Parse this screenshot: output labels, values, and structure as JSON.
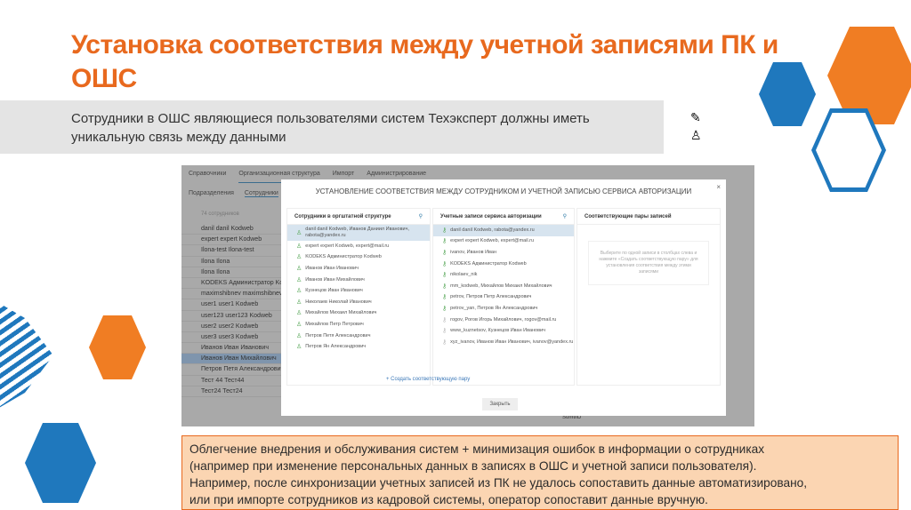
{
  "title": "Установка соответствия между учетной записями ПК и ОШС",
  "subtitle_lines": [
    "Сотрудники в ОШС являющиеся пользователями систем Техэксперт должны иметь",
    "уникальную связь между данными"
  ],
  "icons": [
    "pen-icon",
    "person-icon"
  ],
  "app": {
    "menu": [
      "Справочники",
      "Организационная структура",
      "Импорт",
      "Администрирование"
    ],
    "submenu": [
      "Подразделения",
      "Сотрудники",
      "До"
    ],
    "search_placeholder": "74 сотрудников",
    "employees": [
      "danil danil Kodweb",
      "expert expert Kodweb",
      "Ilona-test Ilona-test",
      "Ilona Ilona",
      "Ilona Ilona",
      "KODEKS Администратор Kodweb",
      "maximshibnev maximshibnev Ko...",
      "user1 user1 Kodweb",
      "user123 user123 Kodweb",
      "user2 user2 Kodweb",
      "user3 user3 Kodweb",
      "Иванов Иван Иванович",
      "Иванов Иван Михайлович",
      "Петров Петя Александрович",
      "Тест 44 Тест44",
      "Тест24 Тест24"
    ],
    "selected_employee": 12,
    "bottom_label": "SumtiID"
  },
  "dialog": {
    "title": "УСТАНОВЛЕНИЕ СООТВЕТСТВИЯ МЕЖДУ СОТРУДНИКОМ И УЧЕТНОЙ ЗАПИСЬЮ СЕРВИСА АВТОРИЗАЦИИ",
    "close": "×",
    "col1_header": "Сотрудники в оргштатной структуре",
    "col1": [
      "danil danil Kodweb, Иванов Даниил Иванович, rabota@yandex.ru",
      "expert expert Kodweb, expert@mail.ru",
      "KODEKS Администратор Kodweb",
      "Иванов Иван Иванович",
      "Иванов Иван Михайлович",
      "Кузнецов Иван Иванович",
      "Николаев Николай Иванович",
      "Михайлов Михаил Михайлович",
      "Михайлов Петр Петрович",
      "Петров Петя Александрович",
      "Петров Ян Александрович"
    ],
    "col2_header": "Учетные записи сервиса авторизации",
    "col2": [
      "danil danil Kodweb, rabota@yandex.ru",
      "expert expert Kodweb, expert@mail.ru",
      "ivanov, Иванов Иван",
      "KODEKS Администратор Kodweb",
      "nikolaev_nik",
      "mm_kodweb, Михайлов Михаил Михайлович",
      "petrov, Петров Петр Александрович",
      "petrov_yan, Петров Ян Александрович",
      "rogov, Рогов Игорь Михайлович, rogov@mail.ru",
      "www_kuznetsov, Кузнецов Иван Иванович",
      "xyz_ivanov, Иванов Иван Иванович, ivanov@yandex.ru"
    ],
    "col2_linked": [
      true,
      true,
      true,
      true,
      true,
      true,
      true,
      true,
      false,
      false,
      false
    ],
    "col3_header": "Соответствующие пары записей",
    "hint": "Выберите по одной записи в столбцах слева и нажмите «Создать соответствующую пару» для установления соответствия между этими записями",
    "create_link": "+ Создать соответствующую пару",
    "close_button": "Закрыть"
  },
  "note_lines": [
    "Облегчение внедрения и обслуживания систем + минимизация ошибок в информации о сотрудниках",
    "(например при изменение персональных данных в записях в ОШС и учетной записи пользователя).",
    "Например, после синхронизации учетных записей из ПК не удалось сопоставить данные автоматизировано,",
    "или при импорте сотрудников из кадровой системы, оператор сопоставит данные вручную."
  ],
  "colors": {
    "orange": "#e8691e",
    "blue": "#1f78bd"
  }
}
